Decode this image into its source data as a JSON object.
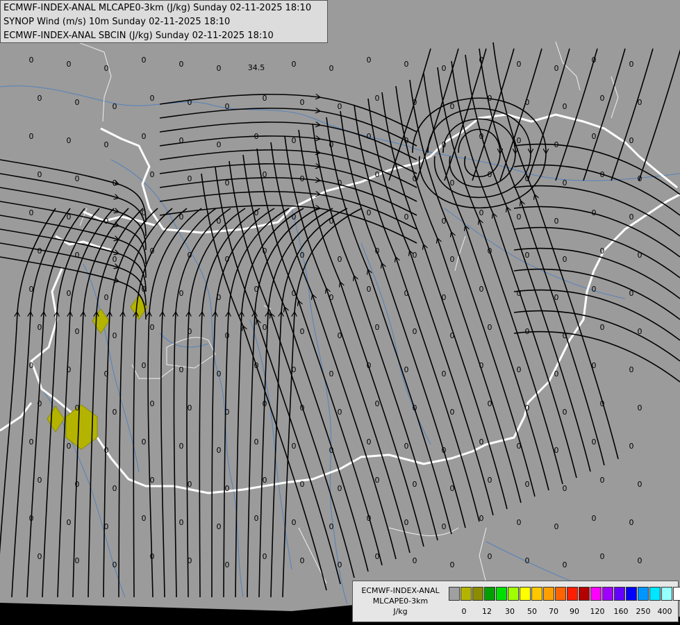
{
  "header": {
    "line1": "ECMWF-INDEX-ANAL MLCAPE0-3km (J/kg) Sunday 02-11-2025 18:10",
    "line2": "SYNOP Wind (m/s) 10m Sunday 02-11-2025 18:10",
    "line3": "ECMWF-INDEX-ANAL SBCIN (J/kg) Sunday 02-11-2025 18:10"
  },
  "legend": {
    "line1": "ECMWF-INDEX-ANAL",
    "line2": "MLCAPE0-3km",
    "unit": "J/kg",
    "colors": [
      "#a0a0a0",
      "#b4b400",
      "#8c8c00",
      "#00a000",
      "#00e000",
      "#a0ff00",
      "#ffff00",
      "#ffc800",
      "#ffa000",
      "#ff6400",
      "#ff1e00",
      "#b40000",
      "#ff00ff",
      "#a000ff",
      "#6400ff",
      "#0000ff",
      "#0096ff",
      "#00e6ff",
      "#96ffff",
      "#ffffff"
    ],
    "ticks": [
      "0",
      "12",
      "30",
      "50",
      "70",
      "90",
      "120",
      "160",
      "250",
      "400"
    ]
  },
  "map": {
    "colors": {
      "background": "#9b9b9b",
      "border": "#ffffff",
      "river": "#4d7fbf",
      "streamline": "#000000",
      "cape_low": "#b4b400",
      "bottom_band": "#000000"
    },
    "highlight_value": "34.5",
    "value_label": "0"
  }
}
